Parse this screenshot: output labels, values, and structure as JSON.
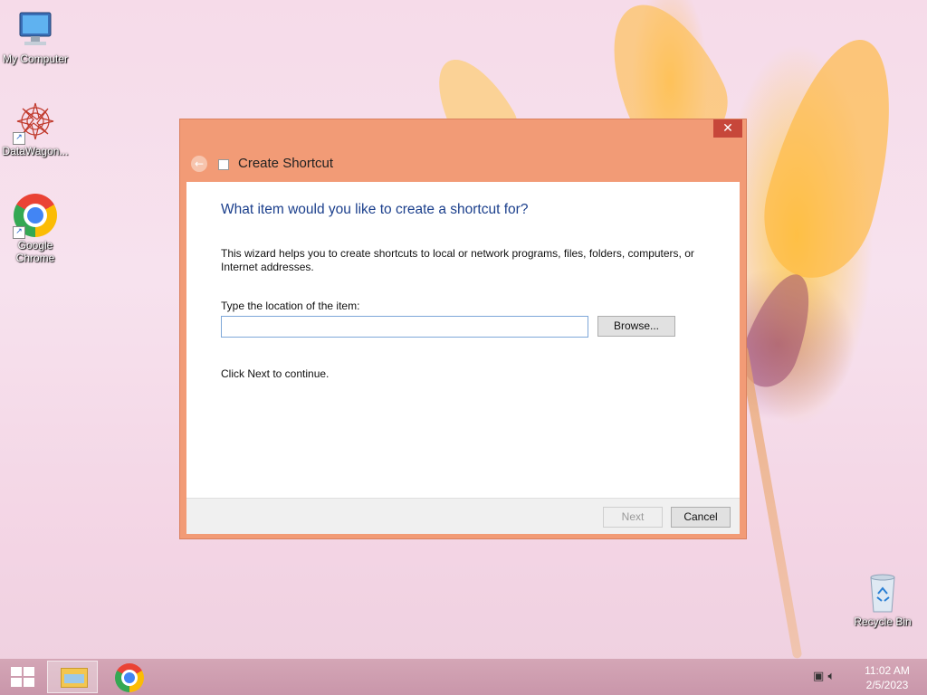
{
  "desktop": {
    "icons": [
      {
        "label": "My Computer",
        "icon": "computer-icon"
      },
      {
        "label": "DataWagon...",
        "icon": "datawagon-icon"
      },
      {
        "label": "Google Chrome",
        "icon": "chrome-icon"
      },
      {
        "label": "Recycle Bin",
        "icon": "recycle-bin-icon"
      }
    ]
  },
  "dialog": {
    "title": "Create Shortcut",
    "close_label": "✕",
    "back_glyph": "←",
    "heading": "What item would you like to create a shortcut for?",
    "description": "This wizard helps you to create shortcuts to local or network programs, files, folders, computers, or Internet addresses.",
    "location_label": "Type the location of the item:",
    "location_value": "",
    "browse_label": "Browse...",
    "continue_text": "Click Next to continue.",
    "next_label": "Next",
    "cancel_label": "Cancel",
    "next_enabled": false
  },
  "taskbar": {
    "items": [
      {
        "name": "File Explorer",
        "icon": "file-explorer-icon",
        "active": true
      },
      {
        "name": "Google Chrome",
        "icon": "chrome-icon",
        "active": false
      }
    ],
    "tray": {
      "network_icon": "network-icon",
      "volume_icon": "volume-icon"
    },
    "clock": {
      "time": "11:02 AM",
      "date": "2/5/2023"
    }
  },
  "colors": {
    "dialog_frame": "#f29b76",
    "heading_blue": "#1b3f8c",
    "close_red": "#c7473a",
    "taskbar": "#cf9daf"
  }
}
